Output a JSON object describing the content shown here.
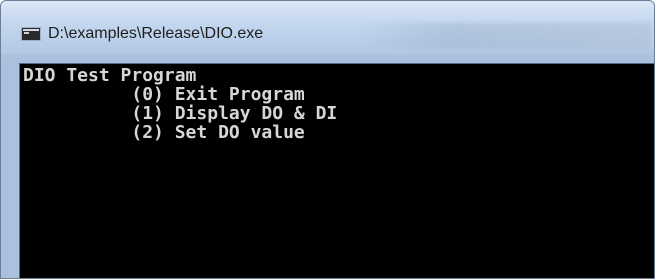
{
  "window": {
    "title": "D:\\examples\\Release\\DIO.exe"
  },
  "console": {
    "lines": [
      "DIO Test Program",
      "          (0) Exit Program",
      "          (1) Display DO & DI",
      "          (2) Set DO value"
    ]
  },
  "icons": {
    "app": "console-app-icon"
  },
  "colors": {
    "console_background": "#000000",
    "console_text": "#d6d6d6",
    "titlebar": "#c3d6ee"
  }
}
